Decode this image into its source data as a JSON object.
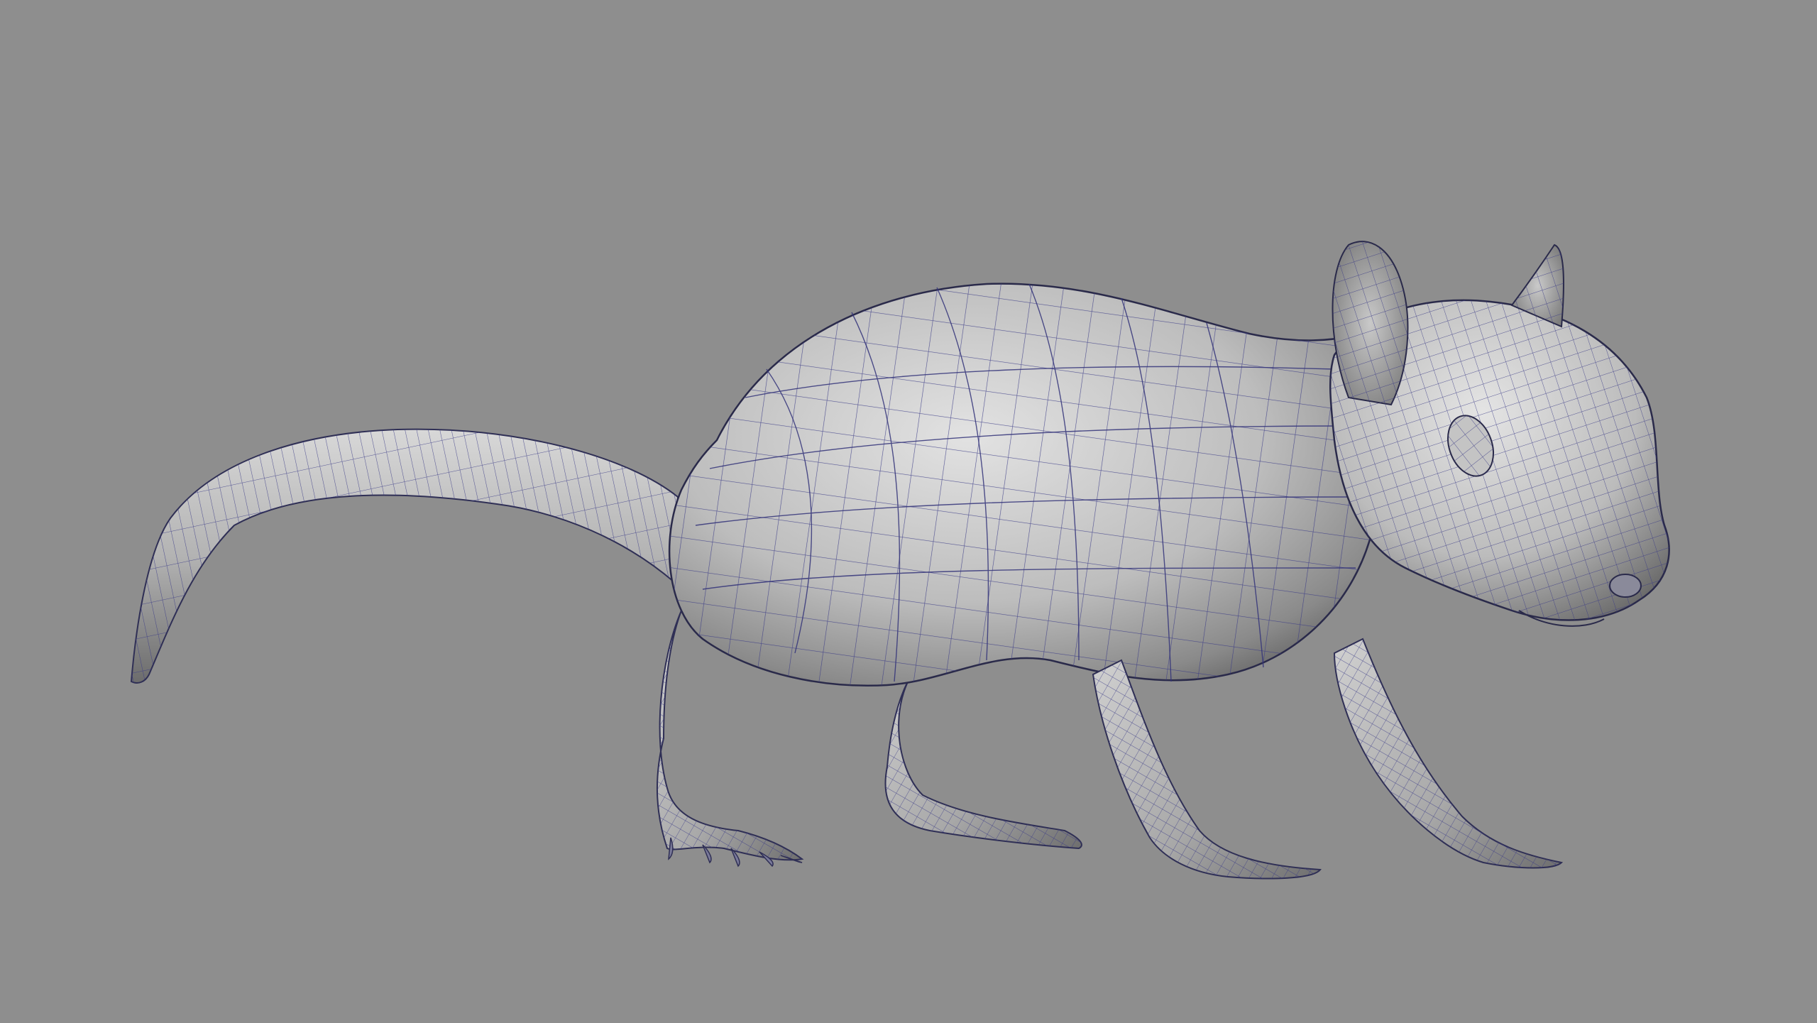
{
  "viewport": {
    "background_color": "#8e8e8e",
    "shading": "smooth-shaded-with-wireframe",
    "wireframe_color": "#3a3a86",
    "surface_light_color": "#dedede",
    "surface_dark_color": "#5a5a5a",
    "subject": "rat-mesh-icon"
  }
}
